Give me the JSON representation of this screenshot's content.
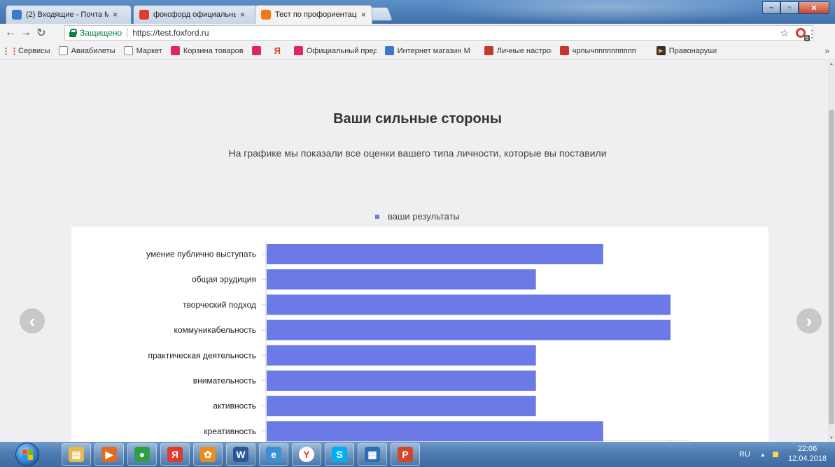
{
  "browser": {
    "tabs": [
      {
        "label": "(2) Входящие - Почта М",
        "icon": "mail-icon",
        "color": "#3b7ac9",
        "active": false
      },
      {
        "label": "фоксфорд официальны",
        "icon": "yandex-icon",
        "color": "#e03b2b",
        "active": false
      },
      {
        "label": "Тест по профориентаци",
        "icon": "foxford-icon",
        "color": "#f07a1a",
        "active": true
      }
    ],
    "tab_close": "×",
    "secure_label": "Защищено",
    "url": "https://test.foxford.ru",
    "extension_badge": "6"
  },
  "bookmarks": {
    "apps_label": "Сервисы",
    "items": [
      {
        "label": "Авиабилеты",
        "icon": "page-icon",
        "color": "#888888"
      },
      {
        "label": "Маркет",
        "icon": "page-icon",
        "color": "#888888"
      },
      {
        "label": "Корзина товаров",
        "icon": "cart-icon",
        "color": "#e0245e"
      },
      {
        "label": "",
        "icon": "cart-icon",
        "color": "#e0245e"
      },
      {
        "label": "",
        "icon": "yandex-icon",
        "color": "#e03b2b"
      },
      {
        "label": "Официальный пред",
        "icon": "cart-icon",
        "color": "#e0245e"
      },
      {
        "label": "Интернет магазин М",
        "icon": "globe-icon",
        "color": "#3b7ac9"
      },
      {
        "label": "Личные настройки -",
        "icon": "grid-icon",
        "color": "#c0392b"
      },
      {
        "label": "чрпычпппппппппп",
        "icon": "grid-icon",
        "color": "#c0392b"
      },
      {
        "label": "Правонарушения в",
        "icon": "play-icon",
        "color": "#f5a623"
      }
    ],
    "more": "»"
  },
  "page": {
    "title": "Ваши сильные стороны",
    "subtitle": "На графике мы показали все оценки вашего типа личности, которые вы поставили",
    "legend": "ваши результаты"
  },
  "chart_data": {
    "type": "bar",
    "orientation": "horizontal",
    "categories": [
      "умение публично выступать",
      "общая эрудиция",
      "творческий подход",
      "коммуникабельность",
      "практическая деятельность",
      "внимательность",
      "активность",
      "креативность"
    ],
    "series": [
      {
        "name": "ваши результаты",
        "values": [
          5,
          4,
          6,
          6,
          4,
          4,
          4,
          5
        ]
      }
    ],
    "xlim": [
      0,
      6.3
    ],
    "color": "#6b7ae7",
    "grid": false
  },
  "taskbar": {
    "apps": [
      {
        "icon": "explorer-icon",
        "color": "#e8b84a",
        "glyph": "▤"
      },
      {
        "icon": "media-player-icon",
        "color": "#e06a1e",
        "glyph": "▶"
      },
      {
        "icon": "chrome-icon",
        "color": "#2f9e44",
        "glyph": "●"
      },
      {
        "icon": "yandex-browser-icon",
        "color": "#e03b2b",
        "glyph": "Я"
      },
      {
        "icon": "ok-icon",
        "color": "#f08a1c",
        "glyph": "✿"
      },
      {
        "icon": "word-icon",
        "color": "#2b5797",
        "glyph": "W"
      },
      {
        "icon": "ie-icon",
        "color": "#3a8fd8",
        "glyph": "e"
      },
      {
        "icon": "yandex-icon",
        "color": "#ffffff",
        "glyph": "Y"
      },
      {
        "icon": "skype-icon",
        "color": "#00aff0",
        "glyph": "S"
      },
      {
        "icon": "store-icon",
        "color": "#2e6db4",
        "glyph": "▦"
      },
      {
        "icon": "powerpoint-icon",
        "color": "#d24726",
        "glyph": "P"
      }
    ],
    "language": "RU",
    "time": "22:06",
    "date": "12.04.2018"
  }
}
